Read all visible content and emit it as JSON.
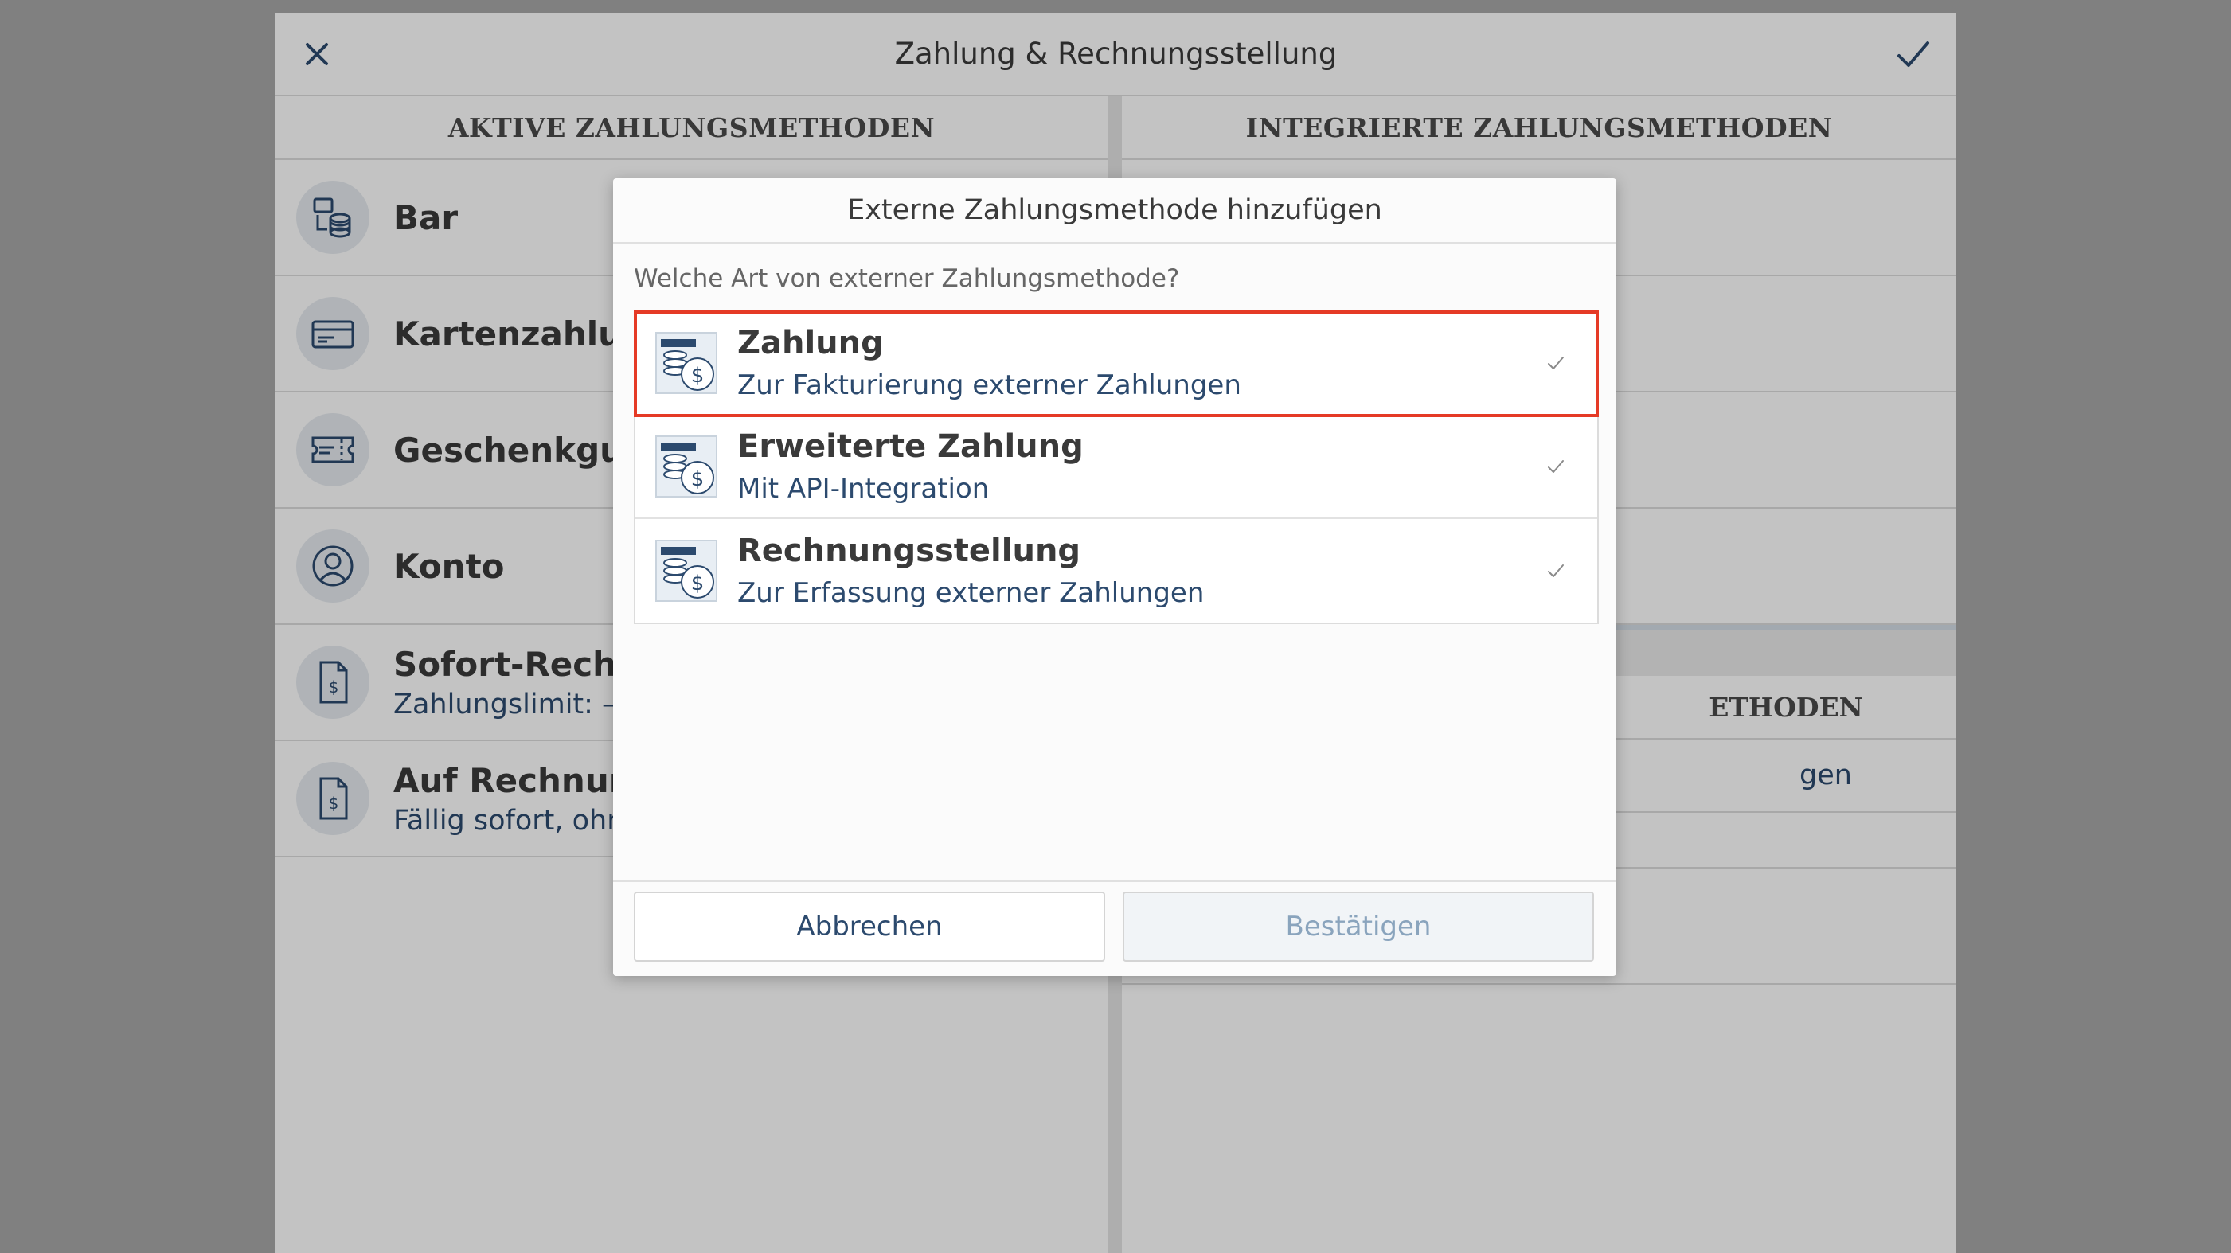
{
  "window": {
    "title": "Zahlung & Rechnungsstellung"
  },
  "left_column": {
    "header": "AKTIVE ZAHLUNGSMETHODEN",
    "items": [
      {
        "label": "Bar",
        "sub": "",
        "icon": "cash-stack-icon"
      },
      {
        "label": "Kartenzahlung",
        "sub": "",
        "icon": "card-icon"
      },
      {
        "label": "Geschenkgutsch",
        "sub": "",
        "icon": "voucher-icon"
      },
      {
        "label": "Konto",
        "sub": "",
        "icon": "account-icon"
      },
      {
        "label": "Sofort-Rechnung",
        "sub": "Zahlungslimit: –,––",
        "icon": "invoice-icon"
      },
      {
        "label": "Auf Rechnung",
        "sub": "Fällig sofort, ohne",
        "icon": "invoice-icon"
      }
    ]
  },
  "right_column": {
    "header": "INTEGRIERTE ZAHLUNGSMETHODEN",
    "header2_partial": "ETHODEN",
    "link_partial": "gen"
  },
  "modal": {
    "title": "Externe Zahlungsmethode hinzufügen",
    "question": "Welche Art von externer Zahlungsmethode?",
    "options": [
      {
        "title": "Zahlung",
        "sub": "Zur Fakturierung externer Zahlungen",
        "selected": true
      },
      {
        "title": "Erweiterte Zahlung",
        "sub": "Mit API-Integration",
        "selected": false
      },
      {
        "title": "Rechnungsstellung",
        "sub": "Zur Erfassung externer Zahlungen",
        "selected": false
      }
    ],
    "cancel_label": "Abbrechen",
    "confirm_label": "Bestätigen"
  },
  "colors": {
    "accent_text": "#2c4a6e",
    "selection_border": "#e53a26",
    "disabled_text": "#8aa4bd"
  }
}
